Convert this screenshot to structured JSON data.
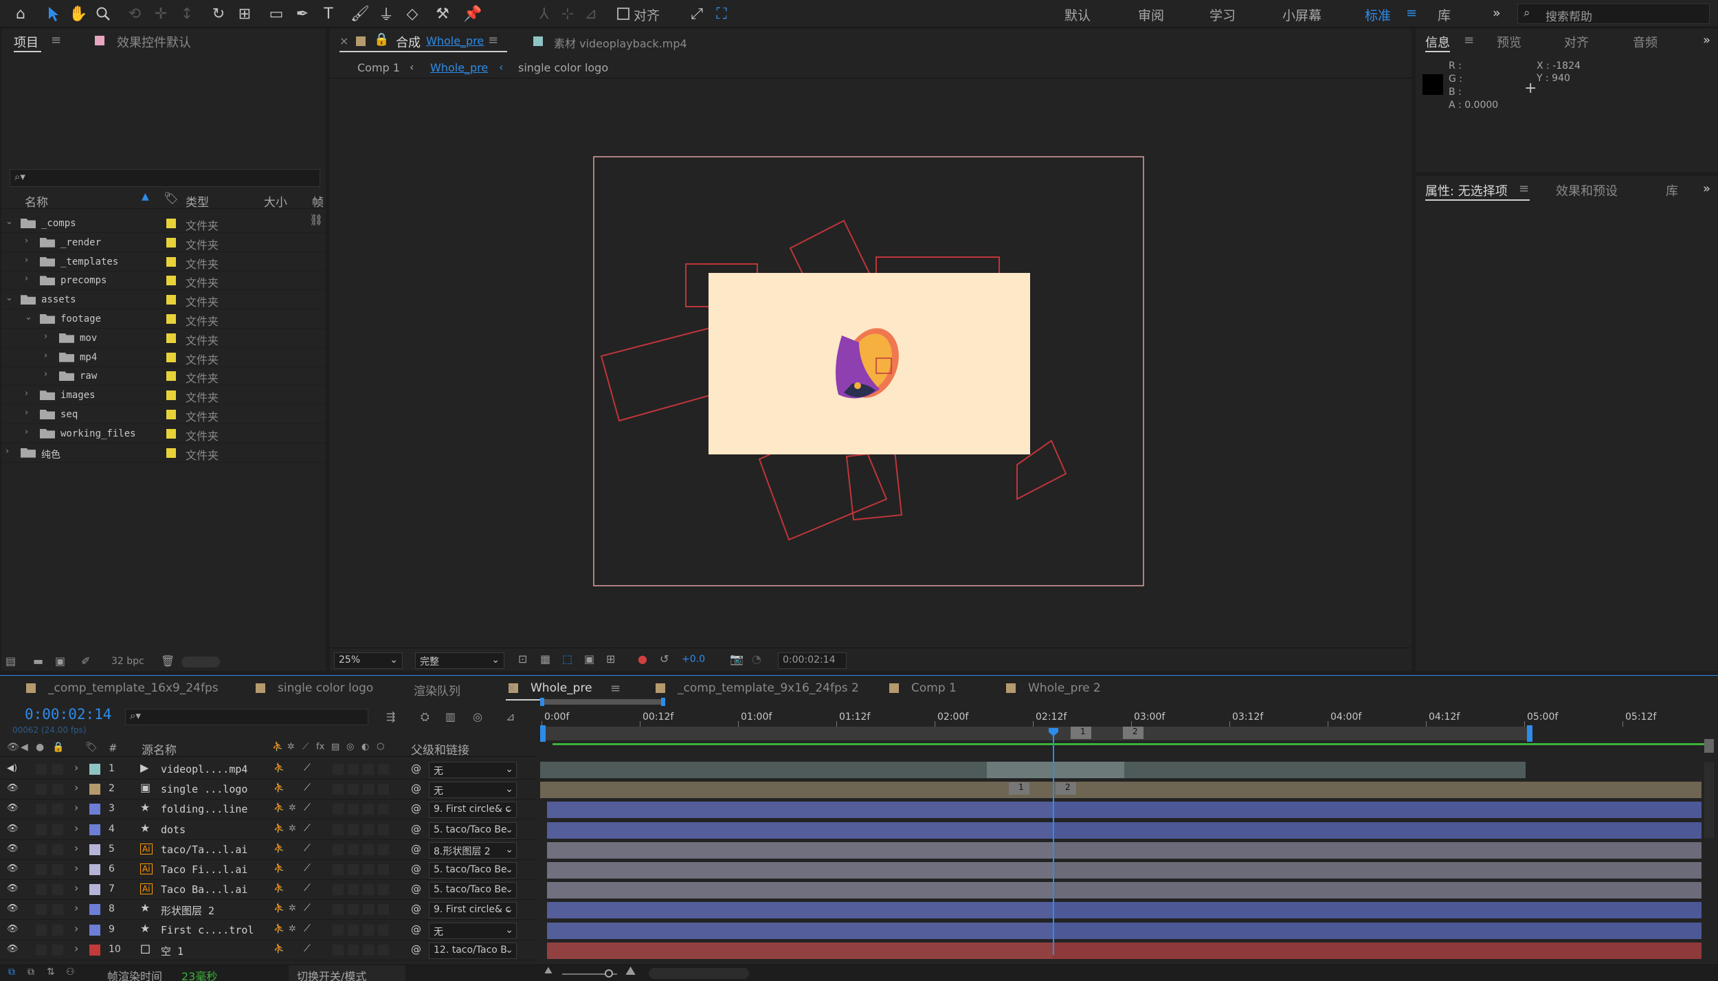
{
  "toolbar": {
    "snap_label": "对齐",
    "workspaces": [
      "默认",
      "审阅",
      "学习",
      "小屏幕",
      "标准",
      "库"
    ],
    "active_workspace": "标准",
    "more": "»",
    "search_placeholder": "搜索帮助"
  },
  "project_panel": {
    "tabs": [
      "项目",
      "效果控件默认"
    ],
    "search_icon_label": "⌕▾",
    "columns": {
      "name": "名称",
      "type": "类型",
      "size": "大小",
      "frame": "帧"
    },
    "items": [
      {
        "name": "_comps",
        "type": "文件夹",
        "depth": 0,
        "expanded": true
      },
      {
        "name": "_render",
        "type": "文件夹",
        "depth": 1,
        "expanded": false
      },
      {
        "name": "_templates",
        "type": "文件夹",
        "depth": 1,
        "expanded": false
      },
      {
        "name": "precomps",
        "type": "文件夹",
        "depth": 1,
        "expanded": false
      },
      {
        "name": "assets",
        "type": "文件夹",
        "depth": 0,
        "expanded": true
      },
      {
        "name": "footage",
        "type": "文件夹",
        "depth": 1,
        "expanded": true
      },
      {
        "name": "mov",
        "type": "文件夹",
        "depth": 2,
        "expanded": false
      },
      {
        "name": "mp4",
        "type": "文件夹",
        "depth": 2,
        "expanded": false
      },
      {
        "name": "raw",
        "type": "文件夹",
        "depth": 2,
        "expanded": false
      },
      {
        "name": "images",
        "type": "文件夹",
        "depth": 1,
        "expanded": false
      },
      {
        "name": "seq",
        "type": "文件夹",
        "depth": 1,
        "expanded": false
      },
      {
        "name": "working_files",
        "type": "文件夹",
        "depth": 1,
        "expanded": false
      },
      {
        "name": "纯色",
        "type": "文件夹",
        "depth": 0,
        "expanded": false
      }
    ],
    "footer_bpc": "32 bpc"
  },
  "comp_panel": {
    "tab_comp_prefix": "合成",
    "tab_comp_name": "Whole_pre",
    "tab_footage": "素材 videoplayback.mp4",
    "breadcrumb": [
      "Comp 1",
      "Whole_pre",
      "single color logo"
    ],
    "zoom": "25%",
    "quality": "完整",
    "exposure": "+0.0",
    "timecode": "0:00:02:14"
  },
  "info_panel": {
    "tabs": [
      "信息",
      "预览",
      "对齐",
      "音频"
    ],
    "r": "R :",
    "g": "G :",
    "b": "B :",
    "a": "A : 0.0000",
    "x": "X : -1824",
    "y": "Y : 940"
  },
  "properties_panel": {
    "tabs": [
      "属性: 无选择项",
      "效果和预设",
      "库"
    ]
  },
  "timeline": {
    "tabs": [
      {
        "name": "_comp_template_16x9_24fps",
        "color": "#b59a6e"
      },
      {
        "name": "single color logo",
        "color": "#b59a6e"
      },
      {
        "name": "渲染队列",
        "color": ""
      },
      {
        "name": "Whole_pre",
        "color": "#b59a6e"
      },
      {
        "name": "_comp_template_9x16_24fps 2",
        "color": "#b59a6e"
      },
      {
        "name": "Comp 1",
        "color": "#b59a6e"
      },
      {
        "name": "Whole_pre 2",
        "color": "#b59a6e"
      }
    ],
    "timecode": "0:00:02:14",
    "frame_info": "00062 (24.00 fps)",
    "columns": {
      "num": "#",
      "source": "源名称",
      "parent": "父级和链接"
    },
    "ruler": [
      "0:00f",
      "00:12f",
      "01:00f",
      "01:12f",
      "02:00f",
      "02:12f",
      "03:00f",
      "03:12f",
      "04:00f",
      "04:12f",
      "05:00f",
      "05:12f"
    ],
    "markers": [
      "1",
      "2"
    ],
    "layers": [
      {
        "num": "1",
        "name": "videopl....mp4",
        "parent": "无",
        "label": "#8fc4c4",
        "kind": "video"
      },
      {
        "num": "2",
        "name": "single ...logo",
        "parent": "无",
        "label": "#b59a6e",
        "kind": "comp"
      },
      {
        "num": "3",
        "name": "folding...line",
        "parent": "9. First circle& c",
        "label": "#6d7ed6",
        "kind": "shape"
      },
      {
        "num": "4",
        "name": "dots",
        "parent": "5. taco/Taco Be",
        "label": "#6d7ed6",
        "kind": "shape"
      },
      {
        "num": "5",
        "name": "taco/Ta...l.ai",
        "parent": "8.形状图层 2",
        "label": "#b5b5d8",
        "kind": "ai"
      },
      {
        "num": "6",
        "name": "Taco Fi...l.ai",
        "parent": "5. taco/Taco Be",
        "label": "#b5b5d8",
        "kind": "ai"
      },
      {
        "num": "7",
        "name": "Taco Ba...l.ai",
        "parent": "5. taco/Taco Be",
        "label": "#b5b5d8",
        "kind": "ai"
      },
      {
        "num": "8",
        "name": "形状图层 2",
        "parent": "9. First circle& c",
        "label": "#6d7ed6",
        "kind": "shape"
      },
      {
        "num": "9",
        "name": "First c....trol",
        "parent": "无",
        "label": "#6d7ed6",
        "kind": "shape"
      },
      {
        "num": "10",
        "name": "空 1",
        "parent": "12. taco/Taco B",
        "label": "#c23a3a",
        "kind": "null"
      }
    ],
    "footer_render_label": "帧渲染时间",
    "footer_render_value": "23毫秒",
    "footer_toggle": "切换开关/模式"
  }
}
